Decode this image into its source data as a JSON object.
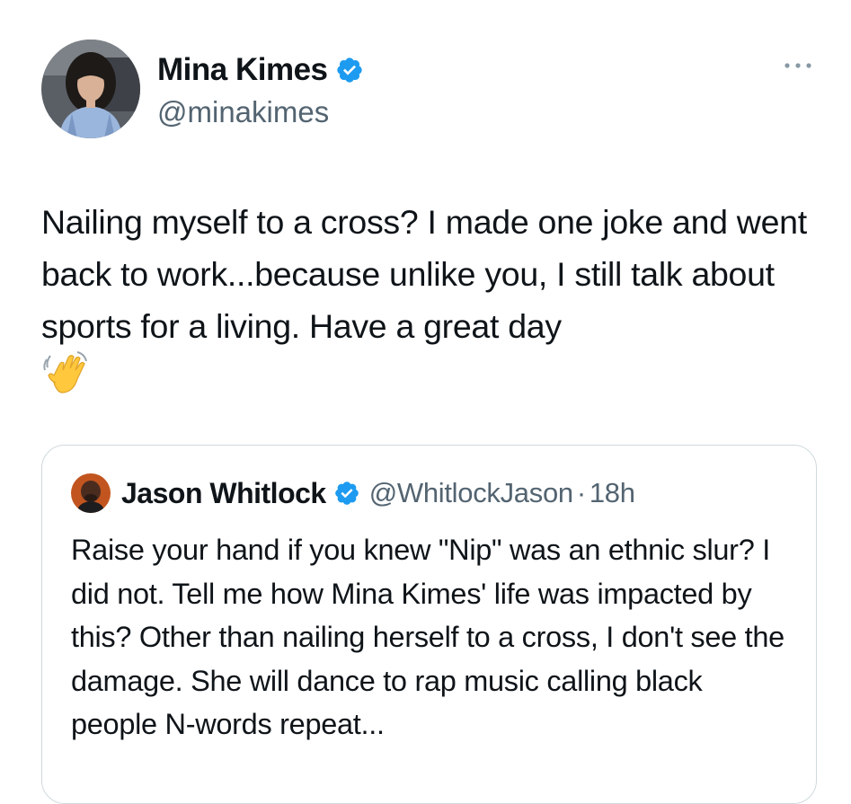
{
  "tweet": {
    "author": {
      "name": "Mina Kimes",
      "handle": "@minakimes",
      "verified": true,
      "avatar_icon": "profile-photo-woman"
    },
    "more_icon": "ellipsis-icon",
    "text": "Nailing myself to a cross? I made one joke and went back to work...because unlike you, I still talk about sports for a living. Have a great day",
    "emoji": "waving-hand-emoji"
  },
  "quoted_tweet": {
    "author": {
      "name": "Jason Whitlock",
      "handle": "@WhitlockJason",
      "verified": true,
      "avatar_icon": "profile-photo-man"
    },
    "separator": "·",
    "time": "18h",
    "text": "Raise your hand if you knew \"Nip\" was an ethnic slur? I did not. Tell me how Mina Kimes' life was impacted by this? Other than nailing herself to a cross, I don't see the damage. She will dance to rap music calling black people N-words repeat..."
  },
  "colors": {
    "text": "#0f1419",
    "secondary": "#536471",
    "verified_blue": "#1d9bf0",
    "border": "#cfd9de"
  }
}
